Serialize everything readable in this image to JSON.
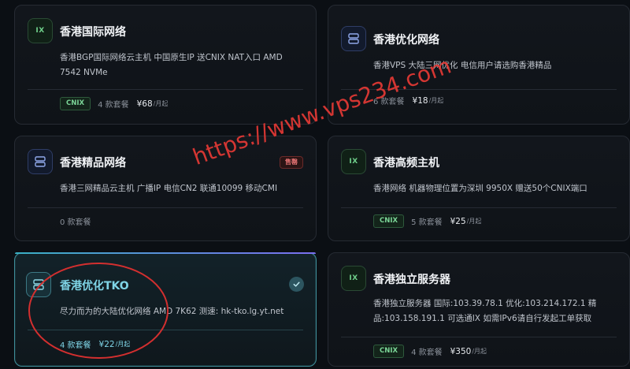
{
  "watermark": "https://www.vps234.com",
  "cards": [
    {
      "id": "hk-intl",
      "icon": "IX",
      "title": "香港国际网络",
      "desc": "香港BGP国际网络云主机 中国原生IP 送CNIX NAT入口 AMD 7542 NVMe",
      "badge": "CNIX",
      "count": "4 款套餐",
      "price": "¥68",
      "unit": "/月起"
    },
    {
      "id": "hk-opt",
      "title": "香港优化网络",
      "desc": "香港VPS 大陆三网优化 电信用户请选购香港精品",
      "count": "6 款套餐",
      "price": "¥18",
      "unit": "/月起"
    },
    {
      "id": "hk-premium",
      "title": "香港精品网络",
      "status": "售罄",
      "desc": "香港三网精品云主机 广播IP 电信CN2 联通10099 移动CMI",
      "count": "0 款套餐"
    },
    {
      "id": "hk-highfreq",
      "icon": "IX",
      "title": "香港高频主机",
      "desc": "香港网络 机器物理位置为深圳 9950X 赠送50个CNIX端口",
      "badge": "CNIX",
      "count": "5 款套餐",
      "price": "¥25",
      "unit": "/月起"
    },
    {
      "id": "hk-tko",
      "title": "香港优化TKO",
      "desc": "尽力而为的大陆优化网络 AMD 7K62 测速: hk-tko.lg.yt.net",
      "count": "4 款套餐",
      "price": "¥22",
      "unit": "/月起"
    },
    {
      "id": "hk-dedicated",
      "icon": "IX",
      "title": "香港独立服务器",
      "desc": "香港独立服务器 国际:103.39.78.1 优化:103.214.172.1 精品:103.158.191.1 可选通IX 如需IPv6请自行发起工单获取",
      "badge": "CNIX",
      "count": "4 款套餐",
      "price": "¥350",
      "unit": "/月起"
    }
  ]
}
